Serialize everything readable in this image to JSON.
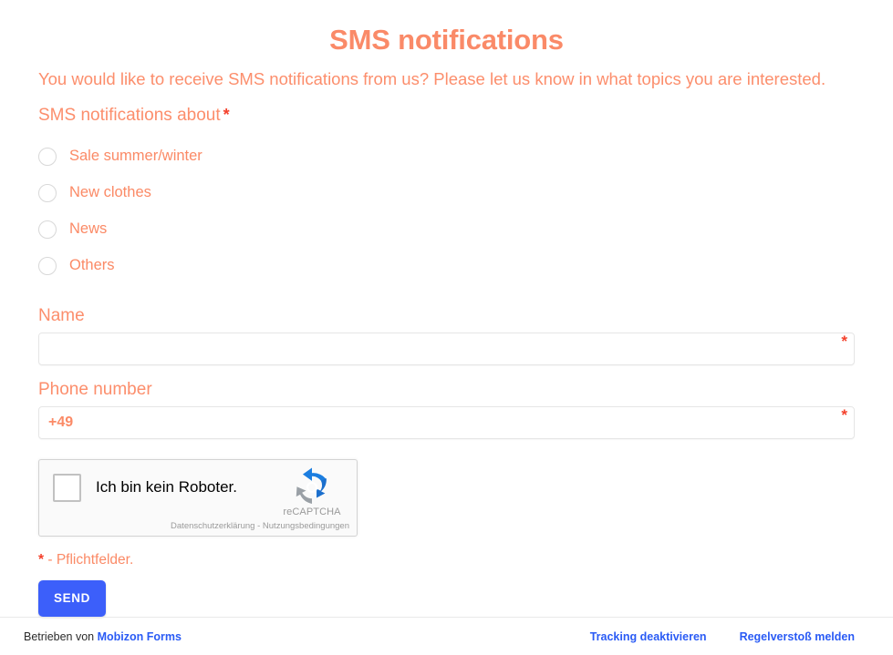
{
  "form": {
    "title": "SMS notifications",
    "intro": "You would like to receive SMS notifications from us? Please let us know in what topics you are interested.",
    "group_label": "SMS notifications about",
    "required_marker": "*",
    "options": [
      {
        "label": "Sale summer/winter",
        "selected": false
      },
      {
        "label": "New clothes",
        "selected": false
      },
      {
        "label": "News",
        "selected": false
      },
      {
        "label": "Others",
        "selected": false
      }
    ],
    "fields": [
      {
        "label": "Name",
        "value": "",
        "placeholder": "",
        "required_marker": "*"
      },
      {
        "label": "Phone number",
        "value": "+49",
        "placeholder": "",
        "required_marker": "*"
      }
    ],
    "required_note_star": "*",
    "required_note_text": "- Pflichtfelder.",
    "submit_label": "SEND"
  },
  "recaptcha": {
    "checkbox_label": "Ich bin kein Roboter.",
    "brand_label": "reCAPTCHA",
    "privacy_link": "Datenschutzerklärung",
    "separator": "-",
    "terms_link": "Nutzungsbedingungen",
    "checked": false
  },
  "footer": {
    "powered_by_text": "Betrieben von",
    "powered_by_link": "Mobizon Forms",
    "tracking_link": "Tracking deaktivieren",
    "report_link": "Regelverstoß melden"
  },
  "colors": {
    "accent": "#fc8e6c",
    "title": "#fa8a68",
    "option_text": "#fb8a66",
    "required_star": "#f4402b",
    "submit_bg": "#3c5ffa",
    "link": "#2a5bf5",
    "recaptcha_blue": "#1c7ee0",
    "recaptcha_gray": "#9aa0a6"
  }
}
